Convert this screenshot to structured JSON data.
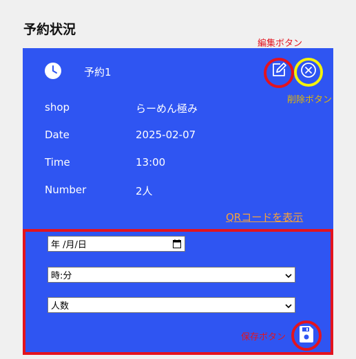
{
  "page": {
    "title": "予約状況"
  },
  "reservation": {
    "title": "予約1",
    "rows": [
      {
        "label": "shop",
        "value": "らーめん極み"
      },
      {
        "label": "Date",
        "value": "2025-02-07"
      },
      {
        "label": "Time",
        "value": "13:00"
      },
      {
        "label": "Number",
        "value": "2人"
      }
    ],
    "qr_link": "QRコードを表示"
  },
  "form": {
    "date_placeholder": "年 /月/日",
    "time_select": "時:分",
    "people_select": "人数"
  },
  "annotations": {
    "edit": "編集ボタン",
    "delete": "削除ボタン",
    "save": "保存ボタン"
  },
  "colors": {
    "card": "#2f55f2",
    "link": "#f6a13b",
    "highlight_red": "#e3131e",
    "highlight_yellow": "#f5f20a"
  },
  "icons": {
    "clock": "clock-icon",
    "edit": "edit-icon",
    "delete": "close-circle-icon",
    "save": "save-icon",
    "calendar": "calendar-icon",
    "chevron": "chevron-down-icon"
  }
}
